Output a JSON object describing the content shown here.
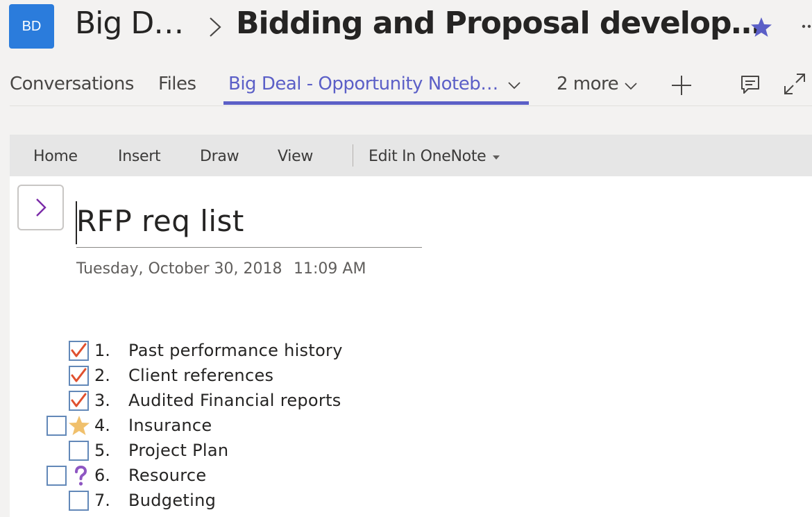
{
  "header": {
    "avatar_initials": "BD",
    "team_name": "Big D…",
    "channel_name": "Bidding and Proposal develop…"
  },
  "tabs": {
    "conversations": "Conversations",
    "files": "Files",
    "active": "Big Deal - Opportunity Noteb…",
    "more": "2 more"
  },
  "ribbon": {
    "home": "Home",
    "insert": "Insert",
    "draw": "Draw",
    "view": "View",
    "edit_in_onenote": "Edit In OneNote"
  },
  "page": {
    "title": "RFP req list",
    "date": "Tuesday, October 30, 2018",
    "time": "11:09 AM"
  },
  "todo_items": [
    {
      "number": "1.",
      "text": "Past performance history",
      "checked": true,
      "extra_tag": ""
    },
    {
      "number": "2.",
      "text": "Client references",
      "checked": true,
      "extra_tag": ""
    },
    {
      "number": "3.",
      "text": "Audited Financial reports",
      "checked": true,
      "extra_tag": ""
    },
    {
      "number": "4.",
      "text": "Insurance",
      "checked": false,
      "extra_tag": "star-icon"
    },
    {
      "number": "5.",
      "text": "Project Plan",
      "checked": false,
      "extra_tag": ""
    },
    {
      "number": "6.",
      "text": "Resource",
      "checked": false,
      "extra_tag": "question-icon"
    },
    {
      "number": "7.",
      "text": "Budgeting",
      "checked": false,
      "extra_tag": ""
    }
  ],
  "colors": {
    "accent": "#5b5fc7",
    "avatar": "#2b7cdc",
    "check": "#e0502e",
    "star_tag": "#f0c06c",
    "question_tag": "#8e56c2",
    "nav_chevron": "#7a2aa8"
  }
}
